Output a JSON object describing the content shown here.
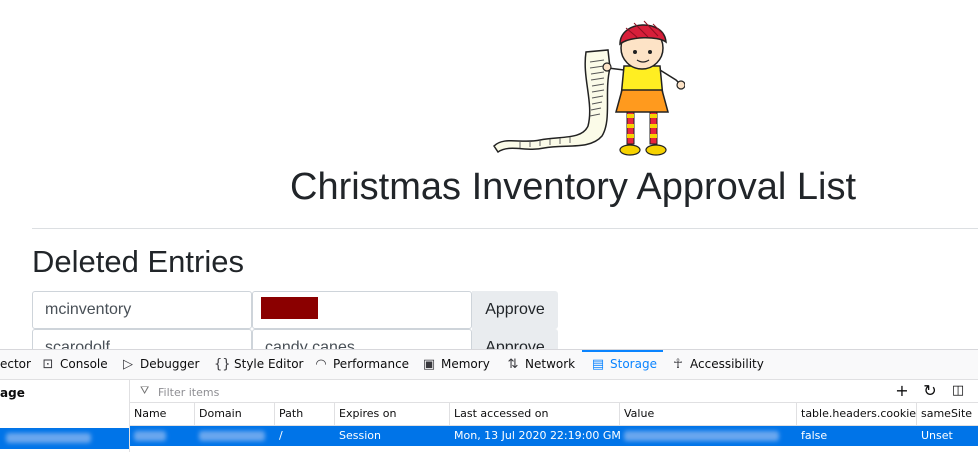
{
  "page": {
    "title": "Christmas Inventory Approval List",
    "section_title": "Deleted Entries",
    "entries": [
      {
        "user": "mcinventory",
        "item": "",
        "item_redacted": true,
        "action": "Approve"
      },
      {
        "user": "scarodolf",
        "item": "candy canes",
        "item_redacted": false,
        "action": "Approve"
      }
    ]
  },
  "devtools": {
    "tabs": [
      {
        "label": "ector",
        "icon": "inspector-icon"
      },
      {
        "label": "Console",
        "icon": "console-icon"
      },
      {
        "label": "Debugger",
        "icon": "debugger-icon"
      },
      {
        "label": "Style Editor",
        "icon": "style-editor-icon"
      },
      {
        "label": "Performance",
        "icon": "performance-icon"
      },
      {
        "label": "Memory",
        "icon": "memory-icon"
      },
      {
        "label": "Network",
        "icon": "network-icon"
      },
      {
        "label": "Storage",
        "icon": "storage-icon",
        "active": true
      },
      {
        "label": "Accessibility",
        "icon": "accessibility-icon"
      }
    ],
    "sidebar_heading": "age",
    "filter_placeholder": "Filter items",
    "columns": [
      "Name",
      "Domain",
      "Path",
      "Expires on",
      "Last accessed on",
      "Value",
      "table.headers.cookies.isHttpOnly",
      "sameSite"
    ],
    "cookie_row": {
      "path": "/",
      "expires": "Session",
      "last_accessed": "Mon, 13 Jul 2020 22:19:00 GMT",
      "http_only": "false",
      "same_site": "Unset"
    },
    "accent_color": "#0a84ff",
    "selection_color": "#0074e8"
  }
}
